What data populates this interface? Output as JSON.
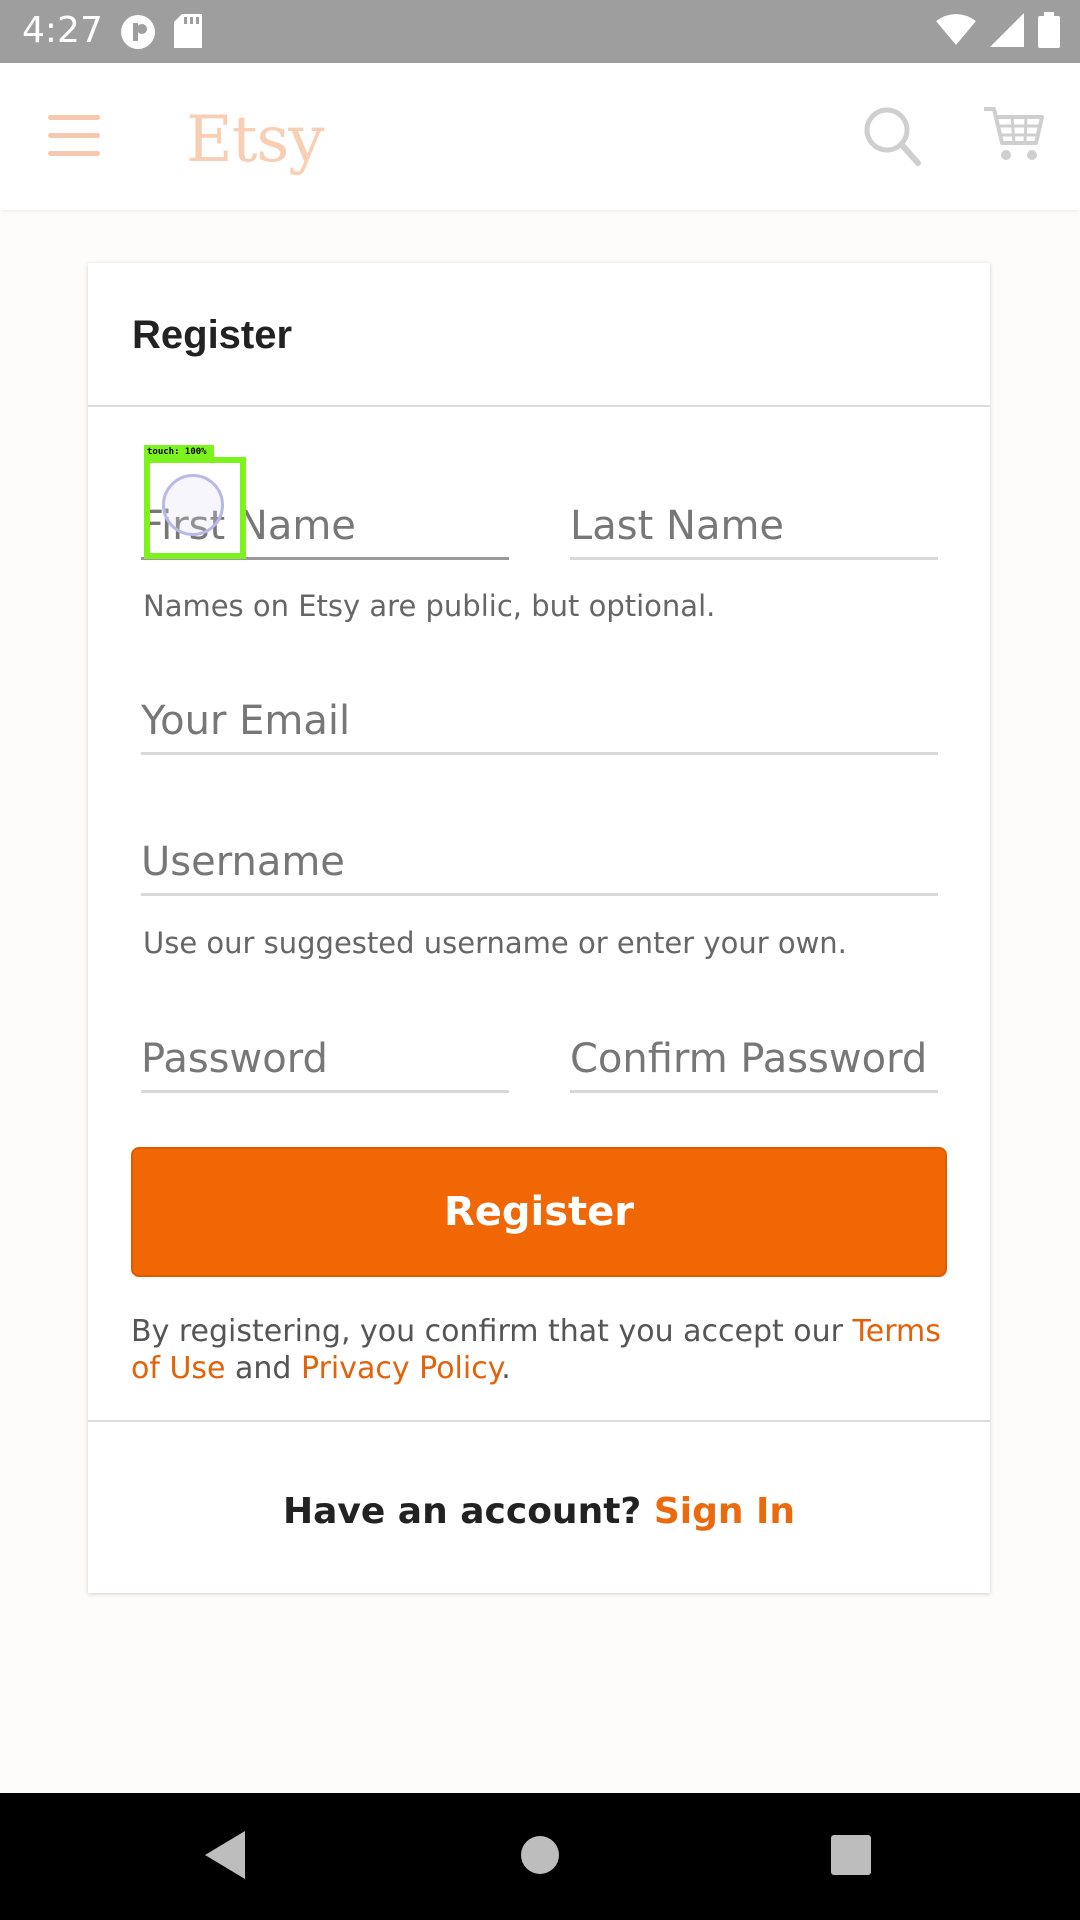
{
  "status_bar": {
    "time": "4:27"
  },
  "app_bar": {
    "logo": "Etsy"
  },
  "register_form": {
    "title": "Register",
    "first_name_placeholder": "First Name",
    "last_name_placeholder": "Last Name",
    "names_helper": "Names on Etsy are public, but optional.",
    "email_placeholder": "Your Email",
    "username_placeholder": "Username",
    "username_helper": "Use our suggested username or enter your own.",
    "password_placeholder": "Password",
    "confirm_password_placeholder": "Confirm Password",
    "register_button_label": "Register",
    "legal_prefix": "By registering, you confirm that you accept our ",
    "terms_link": "Terms of Use",
    "legal_and": " and ",
    "privacy_link": "Privacy Policy",
    "legal_suffix": ".",
    "have_account": "Have an account? ",
    "sign_in_link": "Sign In"
  },
  "touch_indicator": {
    "label": "touch: 100%"
  },
  "colors": {
    "accent": "#f26705",
    "link": "#e3620a",
    "logo": "#f8cfb5",
    "status_bar": "#9e9e9e"
  }
}
